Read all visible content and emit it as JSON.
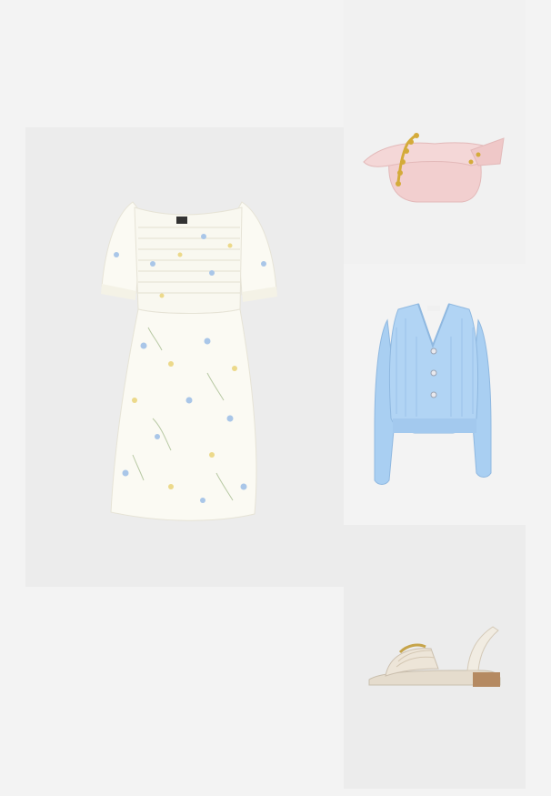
{
  "outfit": {
    "items": [
      {
        "id": "dress",
        "icon": "floral-smocked-dress-image",
        "color": "#fbfaf3"
      },
      {
        "id": "bag",
        "icon": "pink-bow-bag-image",
        "color": "#f2cfcf"
      },
      {
        "id": "cardigan",
        "icon": "blue-knit-cardigan-image",
        "color": "#a9cff2"
      },
      {
        "id": "sandal",
        "icon": "woven-block-heel-sandal-image",
        "color": "#ede5d8"
      }
    ]
  },
  "colors": {
    "page_bg": "#f3f3f3",
    "tile_bg_dark": "#ececec",
    "tile_bg_light": "#f1f1f1"
  }
}
